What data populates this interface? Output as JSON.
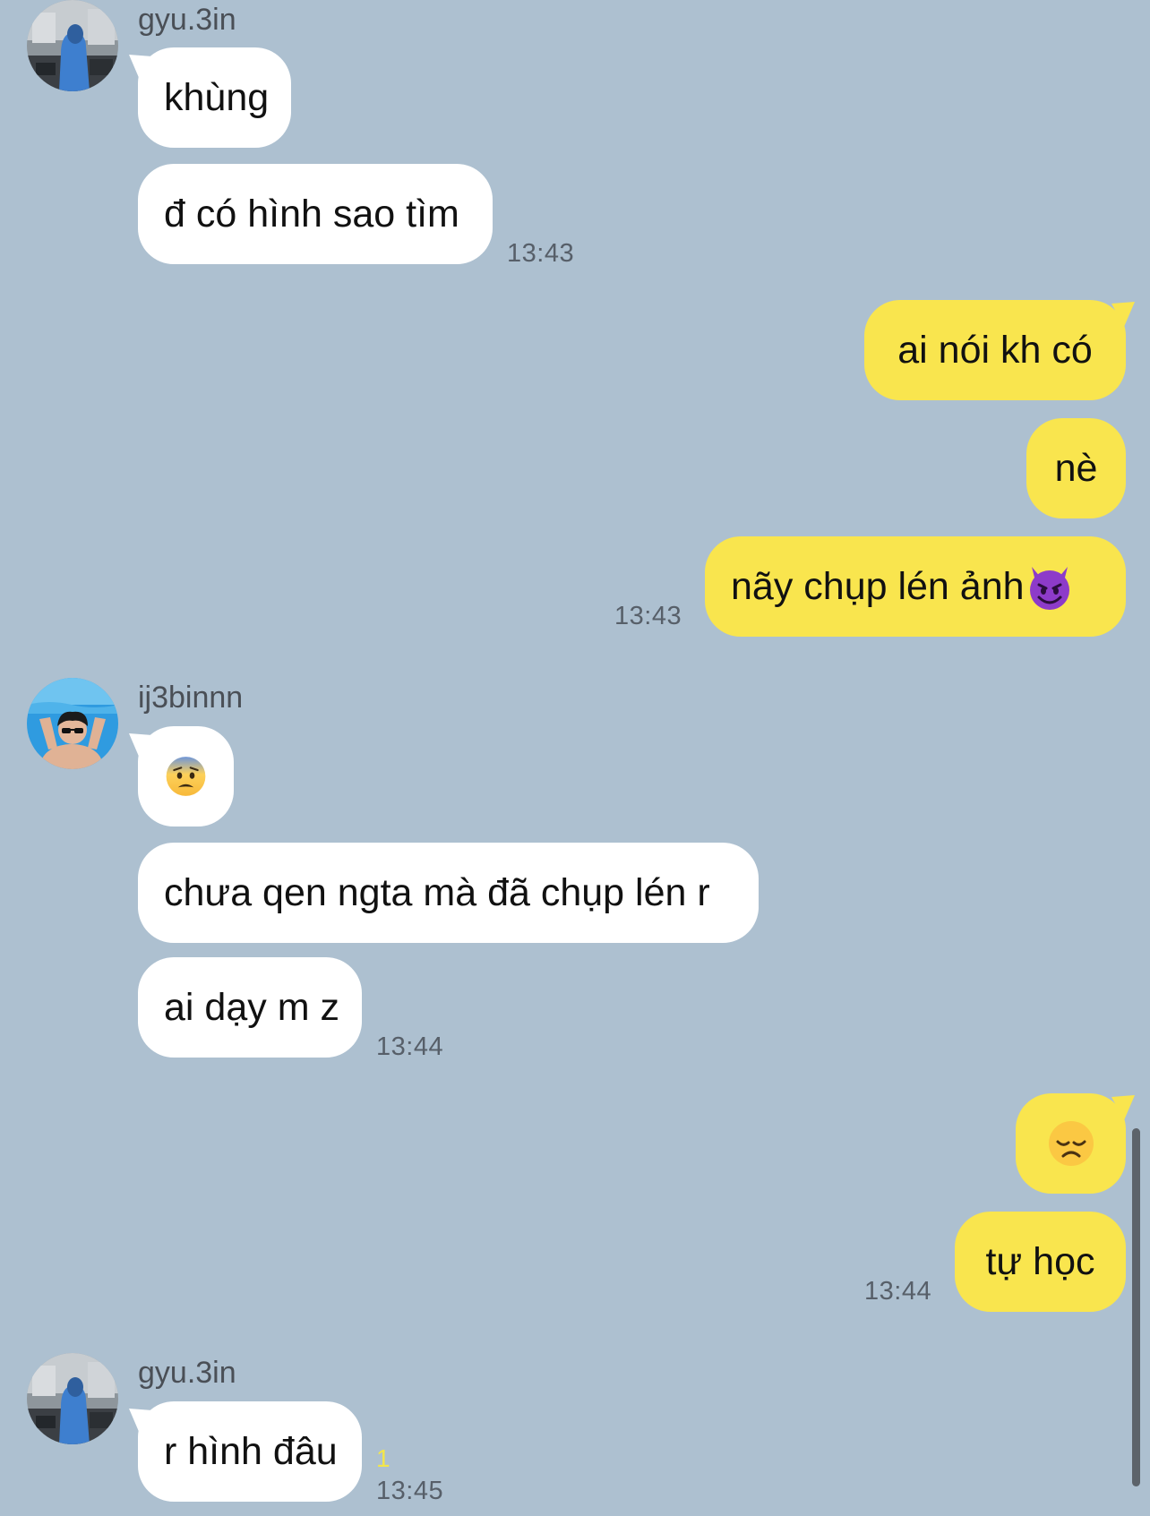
{
  "messages": [
    {
      "sender": "gyu.3in",
      "texts": [
        "khùng",
        "đ có hình sao tìm"
      ],
      "time": "13:43"
    },
    {
      "texts": [
        "ai nói kh có",
        "nè",
        "nãy chụp lén ảnh"
      ],
      "emoji": "smiling-devil-emoji",
      "time": "13:43"
    },
    {
      "sender": "ij3binnn",
      "emoji": "anxious-face-emoji",
      "texts": [
        "chưa qen ngta mà đã chụp lén r",
        "ai dạy m z"
      ],
      "time": "13:44"
    },
    {
      "emoji": "disappointed-face-emoji",
      "texts": [
        "tự học"
      ],
      "time": "13:44"
    },
    {
      "sender": "gyu.3in",
      "texts": [
        "r hình đâu"
      ],
      "unread": "1",
      "time": "13:45"
    }
  ],
  "colors": {
    "background": "#adc0d0",
    "incoming_bubble": "#ffffff",
    "outgoing_bubble": "#f9e54e",
    "unread_count": "#f3e64a"
  }
}
